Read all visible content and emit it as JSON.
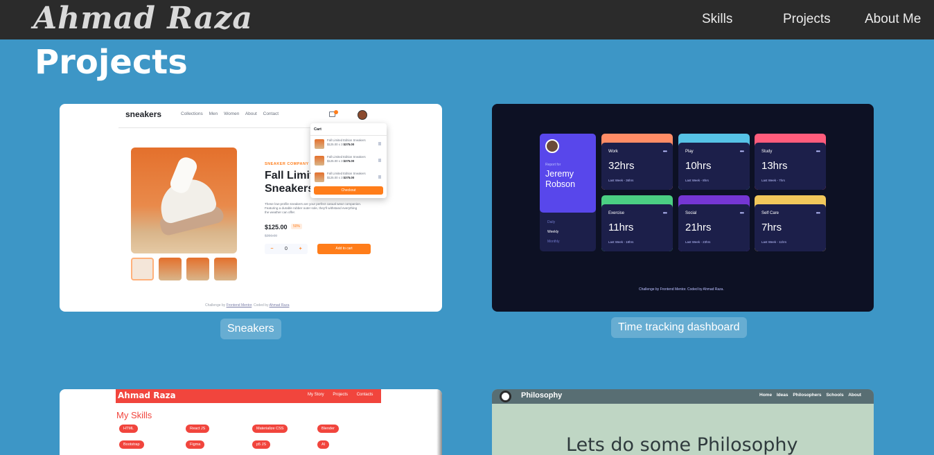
{
  "header": {
    "brand": "Ahmad Raza",
    "nav": [
      "Skills",
      "Projects",
      "About Me"
    ]
  },
  "section_title": "Projects",
  "projects": [
    {
      "caption": "Sneakers",
      "preview": {
        "logo": "sneakers",
        "nav": [
          "Collections",
          "Men",
          "Women",
          "About",
          "Contact"
        ],
        "company": "SNEAKER COMPANY",
        "title_line1": "Fall Limit",
        "title_line2": "Sneakers",
        "description": "These low-profile sneakers are your perfect casual wear companion. Featuring a durable rubber outer sole, they'll withstand everything the weather can offer.",
        "price": "$125.00",
        "discount": "50%",
        "old_price": "$250.00",
        "quantity": "0",
        "minus": "−",
        "plus": "+",
        "add_to_cart": "Add to cart",
        "cart_title": "Cart",
        "cart_item_name": "Fall Limited Edition Sneakers",
        "cart_item_price": "$125.00 x 3",
        "cart_item_total": "$375.00",
        "checkout": "Checkout",
        "footer_prefix": "Challenge by",
        "footer_fm": "Frontend Mentor",
        "footer_mid": ". Coded by",
        "footer_author": "Ahmad Raza"
      }
    },
    {
      "caption": "Time tracking dashboard",
      "preview": {
        "report_for": "Report for",
        "name_line1": "Jeremy",
        "name_line2": "Robson",
        "timeframes": [
          "Daily",
          "Weekly",
          "Monthly"
        ],
        "cards": [
          {
            "label": "Work",
            "hours": "32hrs",
            "previous": "Last Week - 36hrs",
            "color": "#ff8c66"
          },
          {
            "label": "Play",
            "hours": "10hrs",
            "previous": "Last Week - 8hrs",
            "color": "#56c2e6"
          },
          {
            "label": "Study",
            "hours": "13hrs",
            "previous": "Last Week - 7hrs",
            "color": "#ff5c7c"
          },
          {
            "label": "Exercise",
            "hours": "11hrs",
            "previous": "Last Week - 18hrs",
            "color": "#4bcf83"
          },
          {
            "label": "Social",
            "hours": "21hrs",
            "previous": "Last Week - 23hrs",
            "color": "#7536d3"
          },
          {
            "label": "Self Care",
            "hours": "7hrs",
            "previous": "Last Week - 11hrs",
            "color": "#f1c75b"
          }
        ],
        "dots": "•••",
        "footer": "Challenge by Frontend Mentor. Coded by Ahmad Raza."
      }
    },
    {
      "caption": "",
      "preview": {
        "brand": "Ahmad Raza",
        "nav": [
          "My Story",
          "Projects",
          "Contacts"
        ],
        "title": "My Skills",
        "chips": [
          "HTML",
          "React JS",
          "Materialize CSS",
          "Blender",
          "Bootstrap",
          "Figma",
          "p5 JS",
          "AI"
        ]
      }
    },
    {
      "caption": "",
      "preview": {
        "title": "Philosophy",
        "nav": [
          "Home",
          "Ideas",
          "Philosophers",
          "Schools",
          "About"
        ],
        "headline": "Lets do some Philosophy"
      }
    }
  ]
}
